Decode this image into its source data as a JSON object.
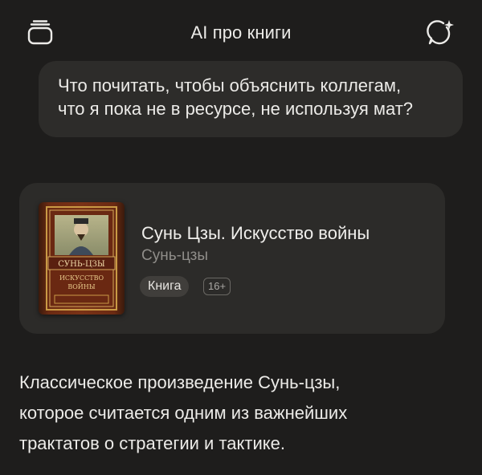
{
  "header": {
    "title": "AI про книги",
    "left_icon": "library-icon",
    "right_icon": "new-chat-icon"
  },
  "user_message": {
    "lines": [
      "Что почитать, чтобы объяснить коллегам,",
      "что я пока не в ресурсе, не используя мат?"
    ]
  },
  "book": {
    "title": "Сунь Цзы. Искусство войны",
    "author": "Сунь-цзы",
    "type_label": "Книга",
    "age_rating": "16+",
    "cover_text": [
      "СУНЬ-ЦЗЫ",
      "ИСКУССТВО",
      "ВОЙНЫ"
    ]
  },
  "answer": {
    "lines": [
      "Классическое произведение Сунь-цзы,",
      "которое считается одним из важнейших",
      "трактатов о стратегии и тактике."
    ]
  },
  "colors": {
    "background": "#1e1d1c",
    "bubble": "#2d2c2a",
    "card": "#2c2b29",
    "text": "#ecebe8",
    "muted": "#8f8d89"
  }
}
